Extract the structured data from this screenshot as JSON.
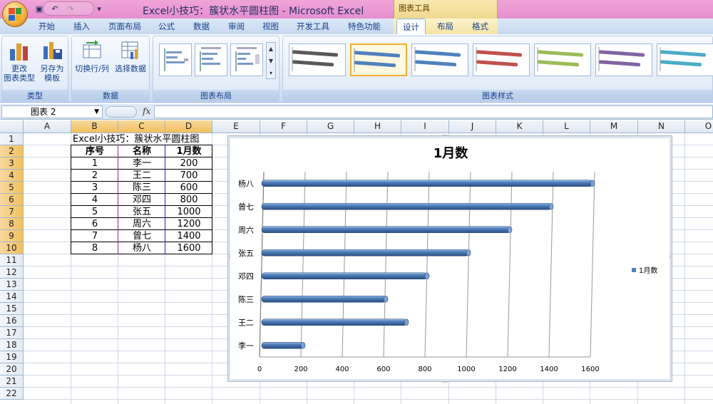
{
  "window": {
    "title": "Excel小技巧：簇状水平圆柱图 - Microsoft Excel",
    "context_tab_group": "图表工具"
  },
  "ribbon": {
    "tabs": [
      "开始",
      "插入",
      "页面布局",
      "公式",
      "数据",
      "审阅",
      "视图",
      "开发工具",
      "特色功能",
      "设计",
      "布局",
      "格式"
    ],
    "active_tab": "设计",
    "groups": {
      "type": {
        "label": "类型",
        "change_chart_type_label": "更改\n图表类型",
        "save_as_template_label": "另存为\n模板"
      },
      "data": {
        "label": "数据",
        "switch_row_col_label": "切换行/列",
        "select_data_label": "选择数据"
      },
      "chart_layout": {
        "label": "图表布局"
      },
      "chart_styles": {
        "label": "图表样式",
        "style_colors": [
          "#595959",
          "#4f81bd",
          "#4f81bd",
          "#c0504d",
          "#9bbb59",
          "#8064a2",
          "#4bacc6"
        ],
        "selected_index": 1
      }
    }
  },
  "formula_bar": {
    "name_box": "图表 2",
    "fx_label": "fx",
    "value": ""
  },
  "grid": {
    "columns": [
      "A",
      "B",
      "C",
      "D",
      "E",
      "F",
      "G",
      "H",
      "I",
      "J",
      "K",
      "L",
      "M",
      "N",
      "O"
    ],
    "rows": [
      "1",
      "2",
      "3",
      "4",
      "5",
      "6",
      "7",
      "8",
      "9",
      "10",
      "11",
      "12",
      "13",
      "14",
      "15",
      "16",
      "17",
      "18",
      "19",
      "20",
      "21",
      "22"
    ],
    "selected_columns": [
      "B",
      "C",
      "D"
    ],
    "table_title": "Excel小技巧：簇状水平圆柱图",
    "table_headers": [
      "序号",
      "名称",
      "1月数"
    ],
    "table_rows": [
      [
        "1",
        "李一",
        "200"
      ],
      [
        "2",
        "王二",
        "700"
      ],
      [
        "3",
        "陈三",
        "600"
      ],
      [
        "4",
        "邓四",
        "800"
      ],
      [
        "5",
        "张五",
        "1000"
      ],
      [
        "6",
        "周六",
        "1200"
      ],
      [
        "7",
        "曾七",
        "1400"
      ],
      [
        "8",
        "杨八",
        "1600"
      ]
    ]
  },
  "chart_data": {
    "type": "bar",
    "title": "1月数",
    "categories": [
      "李一",
      "王二",
      "陈三",
      "邓四",
      "张五",
      "周六",
      "曾七",
      "杨八"
    ],
    "series": [
      {
        "name": "1月数",
        "values": [
          200,
          700,
          600,
          800,
          1000,
          1200,
          1400,
          1600
        ],
        "color": "#4f81bd"
      }
    ],
    "xlim": [
      0,
      1600
    ],
    "x_ticks": [
      0,
      200,
      400,
      600,
      800,
      1000,
      1200,
      1400,
      1600
    ],
    "legend_position": "right",
    "grid": true
  }
}
